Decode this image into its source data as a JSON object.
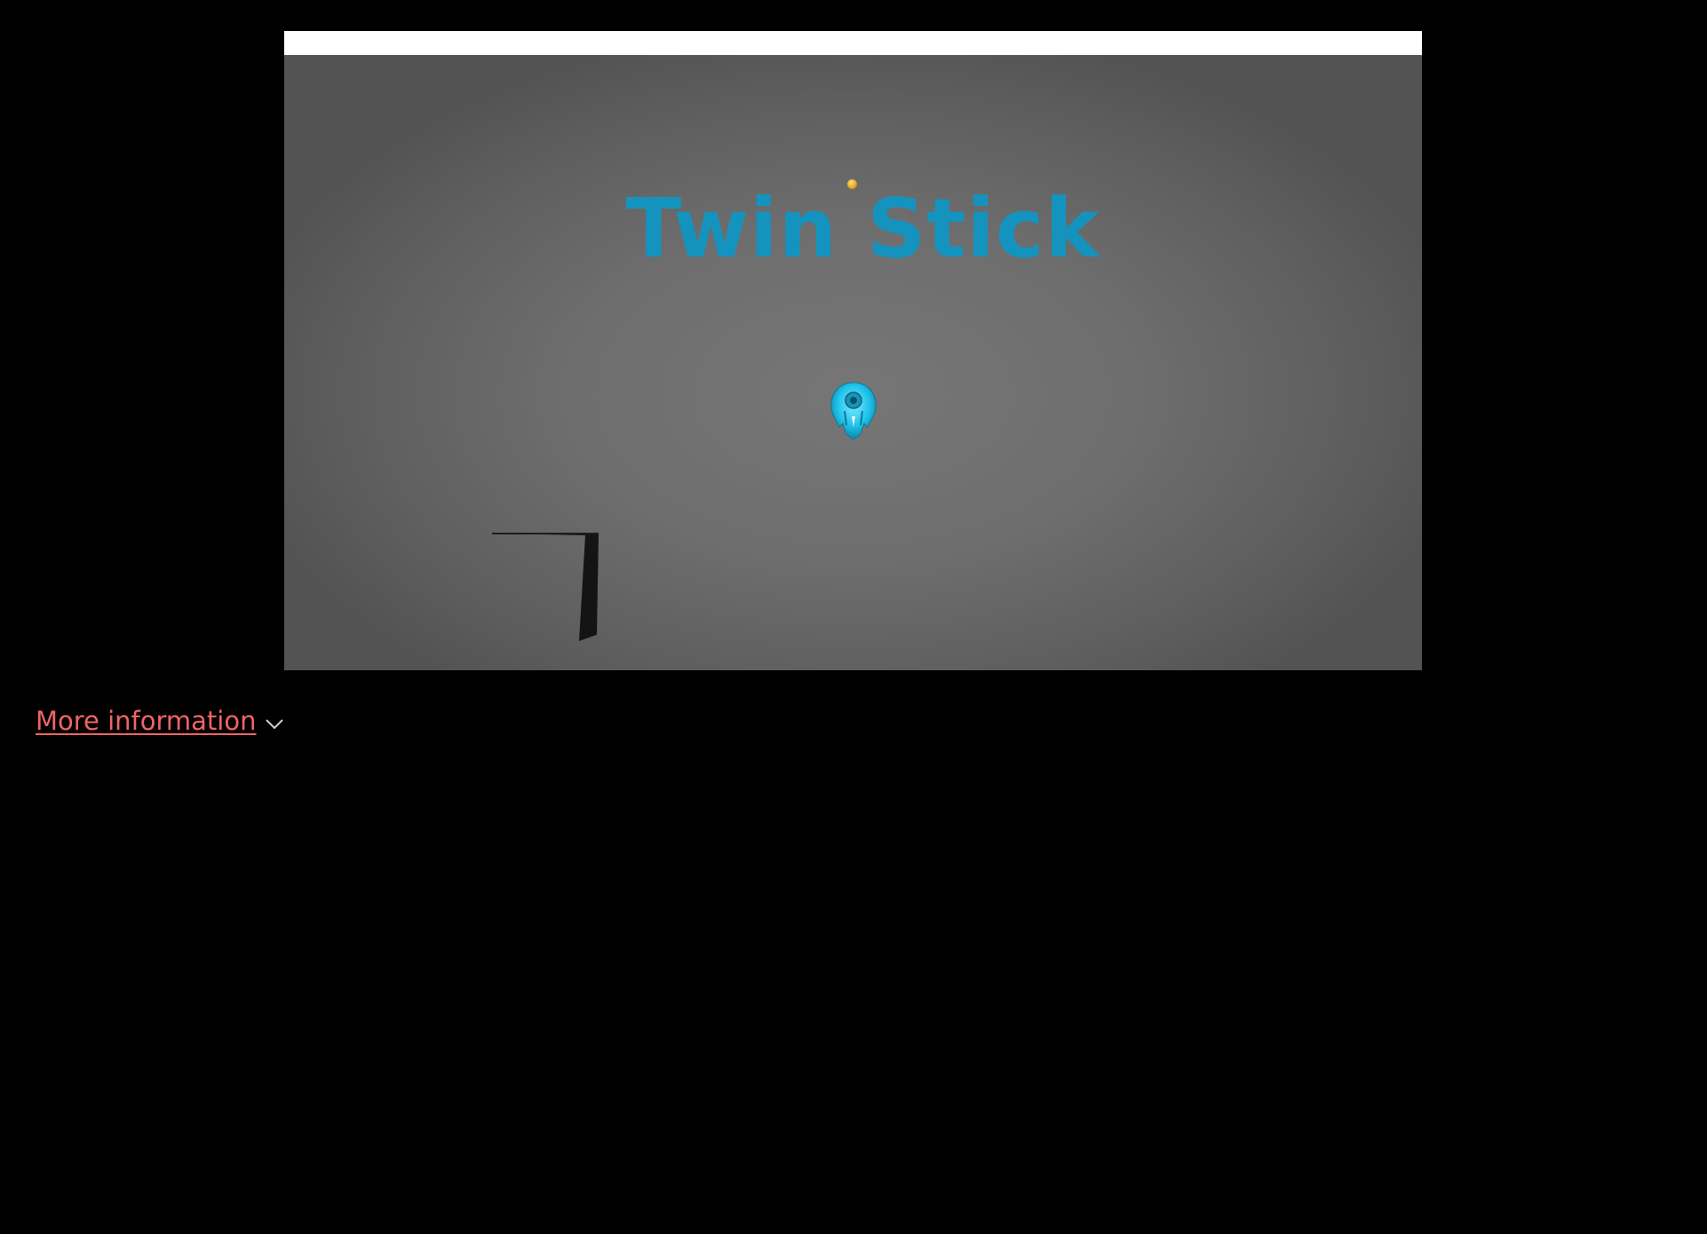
{
  "game": {
    "title": "Twin Stick",
    "title_color": "#1493bf",
    "ship_color": "#1ec3ea",
    "coin_color": "#e5a722",
    "wall_color": "#141414",
    "background_color": "#6e6e6e"
  },
  "footer": {
    "more_info_label": "More information",
    "link_color": "#f06466",
    "icon": "chevron-down-icon"
  }
}
